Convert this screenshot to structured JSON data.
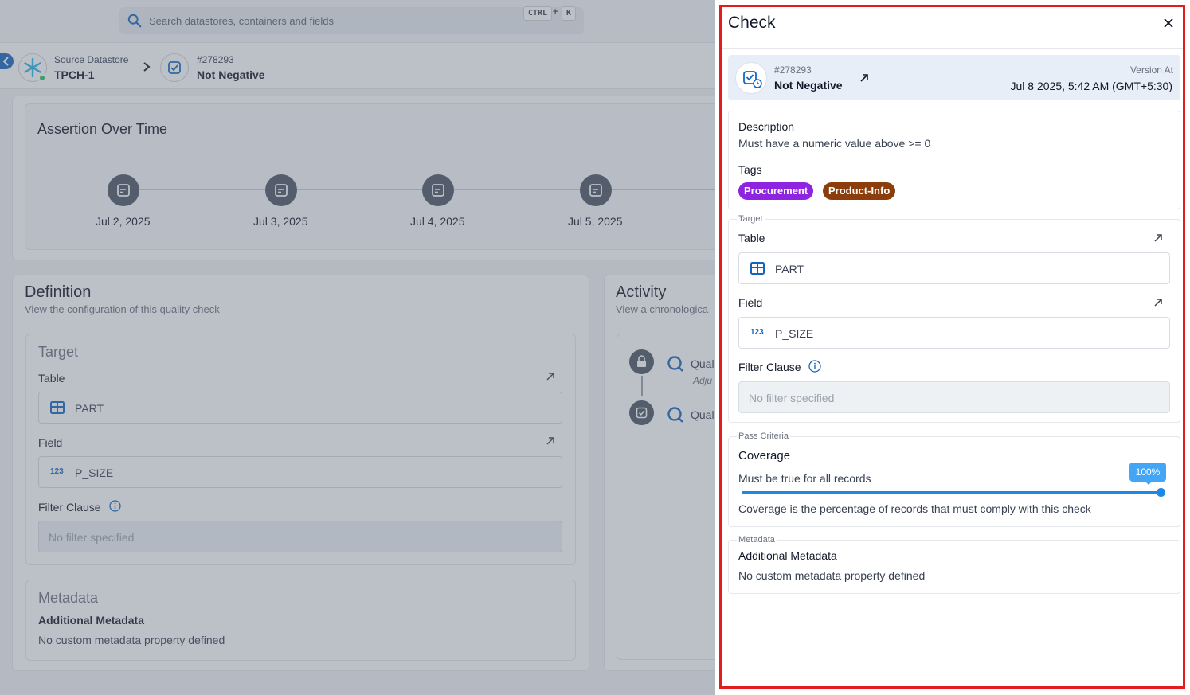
{
  "search": {
    "placeholder": "Search datastores, containers and fields",
    "kbd_ctrl": "CTRL",
    "kbd_plus": "+",
    "kbd_k": "K"
  },
  "breadcrumb": {
    "datastore_label": "Source Datastore",
    "datastore_name": "TPCH-1",
    "check_id": "#278293",
    "check_name": "Not Negative"
  },
  "assertion": {
    "title": "Assertion Over Time",
    "dates": [
      "Jul 2, 2025",
      "Jul 3, 2025",
      "Jul 4, 2025",
      "Jul 5, 2025"
    ]
  },
  "definition": {
    "title": "Definition",
    "subtitle": "View the configuration of this quality check",
    "target_heading": "Target",
    "table_label": "Table",
    "table_value": "PART",
    "field_label": "Field",
    "field_value": "P_SIZE",
    "filter_label": "Filter Clause",
    "filter_placeholder": "No filter specified",
    "metadata_heading": "Metadata",
    "metadata_label": "Additional Metadata",
    "metadata_value": "No custom metadata property defined"
  },
  "activity": {
    "title": "Activity",
    "subtitle": "View a chronologica",
    "items": [
      {
        "text": "Qual",
        "sub": "Adju"
      },
      {
        "text": "Qual",
        "sub": ""
      }
    ]
  },
  "drawer": {
    "title": "Check",
    "check_id": "#278293",
    "check_name": "Not Negative",
    "version_at_label": "Version At",
    "version_date": "Jul 8 2025, 5:42 AM (GMT+5:30)",
    "description_label": "Description",
    "description_value": "Must have a numeric value above >= 0",
    "tags_label": "Tags",
    "tags": [
      {
        "label": "Procurement",
        "color": "#8e24e0"
      },
      {
        "label": "Product-Info",
        "color": "#8b3e0c"
      }
    ],
    "target_legend": "Target",
    "table_label": "Table",
    "table_value": "PART",
    "field_label": "Field",
    "field_type_badge": "123",
    "field_value": "P_SIZE",
    "filter_label": "Filter Clause",
    "filter_placeholder": "No filter specified",
    "pass_legend": "Pass Criteria",
    "coverage_label": "Coverage",
    "coverage_desc": "Must be true for all records",
    "coverage_value": "100%",
    "coverage_fraction": 1.0,
    "coverage_help": "Coverage is the percentage of records that must comply with this check",
    "metadata_legend": "Metadata",
    "metadata_label": "Additional Metadata",
    "metadata_value": "No custom metadata property defined"
  },
  "colors": {
    "accent": "#1e88e5",
    "highlight_frame": "#e11d1d",
    "datastore_status": "#22c55e"
  }
}
